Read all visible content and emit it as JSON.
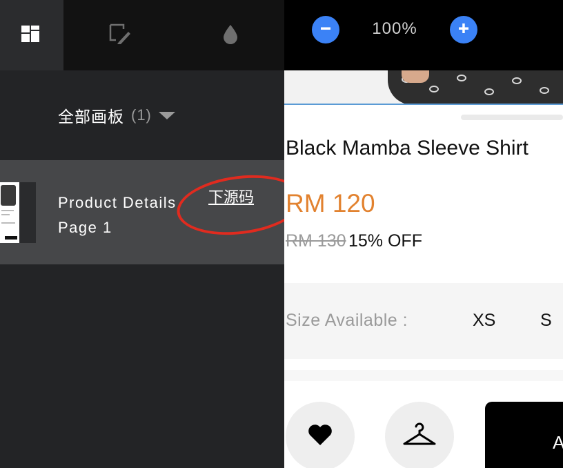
{
  "toolbar": {
    "tabs": [
      {
        "icon": "dashboard-icon",
        "active": true
      },
      {
        "icon": "edit-brush-icon",
        "active": false
      },
      {
        "icon": "water-drop-icon",
        "active": false
      }
    ]
  },
  "boards": {
    "label": "全部画板",
    "count": "(1)"
  },
  "page_item": {
    "title_line1": "Product Details",
    "title_line2": "Page 1",
    "download_link": "下源码"
  },
  "zoom": {
    "minus_icon": "minus-icon",
    "plus_icon": "plus-icon",
    "level": "100%"
  },
  "product": {
    "name": "Black Mamba Sleeve Shirt",
    "price": "RM 120",
    "old_price": "RM 130",
    "discount": "15% OFF",
    "size_label": "Size Available :",
    "sizes": [
      "XS",
      "S"
    ],
    "add_button": "A"
  },
  "colors": {
    "accent_blue": "#3b82f6",
    "price_orange": "#e2822f",
    "annotation_red": "#e02b1f"
  }
}
